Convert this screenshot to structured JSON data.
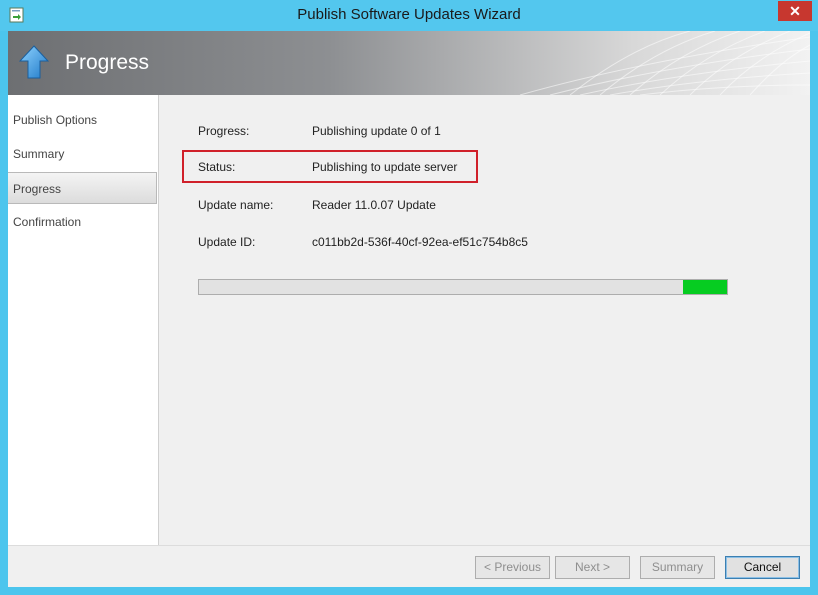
{
  "window": {
    "title": "Publish Software Updates Wizard",
    "close_label": "✕"
  },
  "header": {
    "title": "Progress"
  },
  "sidebar": {
    "items": [
      {
        "label": "Publish Options"
      },
      {
        "label": "Summary"
      },
      {
        "label": "Progress",
        "selected": true
      },
      {
        "label": "Confirmation"
      }
    ]
  },
  "main": {
    "rows": [
      {
        "label": "Progress:",
        "value": "Publishing update 0 of 1"
      },
      {
        "label": "Status:",
        "value": "Publishing to update server"
      },
      {
        "label": "Update name:",
        "value": "Reader 11.0.07 Update"
      },
      {
        "label": "Update ID:",
        "value": "c011bb2d-536f-40cf-92ea-ef51c754b8c5"
      }
    ],
    "progress_indicator": {
      "start_fraction": 0.917,
      "end_fraction": 1.0,
      "color": "#06cc21"
    }
  },
  "footer": {
    "previous_label": "< Previous",
    "next_label": "Next >",
    "summary_label": "Summary",
    "cancel_label": "Cancel"
  },
  "colors": {
    "titlebar": "#53c7ee",
    "highlight_box": "#d0202a",
    "progress_fill": "#06cc21"
  }
}
